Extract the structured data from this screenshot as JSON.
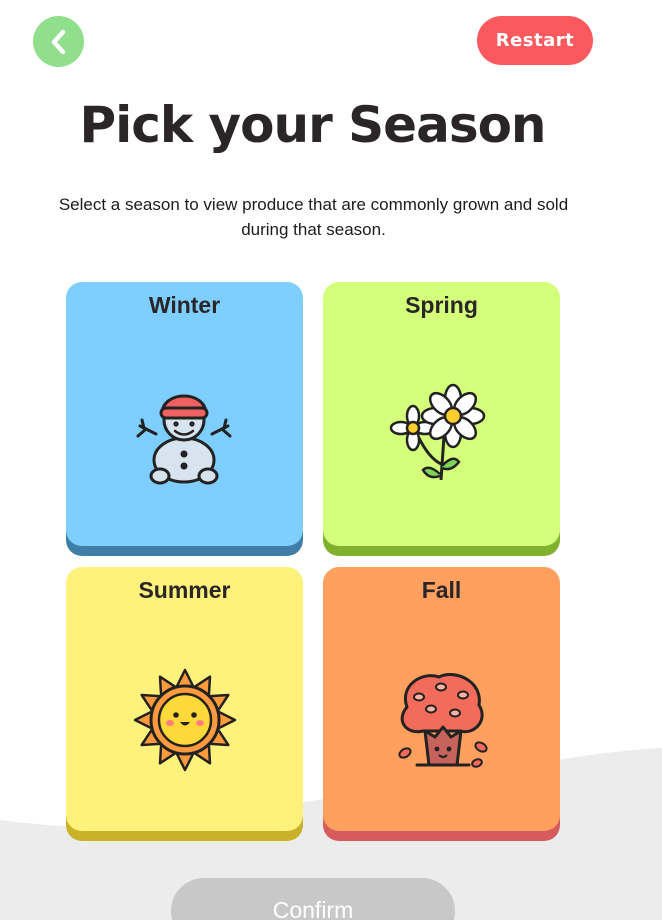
{
  "header": {
    "back_label": "",
    "restart_label": "Restart"
  },
  "title": "Pick your Season",
  "subtitle": "Select a season to view produce that are commonly grown and sold during that season.",
  "seasons": [
    {
      "label": "Winter",
      "icon": "snowman-icon",
      "color": "#7ecfff",
      "shadow": "#3f7fa7"
    },
    {
      "label": "Spring",
      "icon": "flower-icon",
      "color": "#d4ff7a",
      "shadow": "#7fb12c"
    },
    {
      "label": "Summer",
      "icon": "sun-icon",
      "color": "#fff27c",
      "shadow": "#c9b227"
    },
    {
      "label": "Fall",
      "icon": "autumn-tree-icon",
      "color": "#ffa05e",
      "shadow": "#d55b5c"
    }
  ],
  "confirm_label": "Confirm",
  "colors": {
    "back": "#8fdf8c",
    "restart": "#fa5a5e",
    "confirm_disabled": "#c8c8c8",
    "title": "#2a2526"
  }
}
